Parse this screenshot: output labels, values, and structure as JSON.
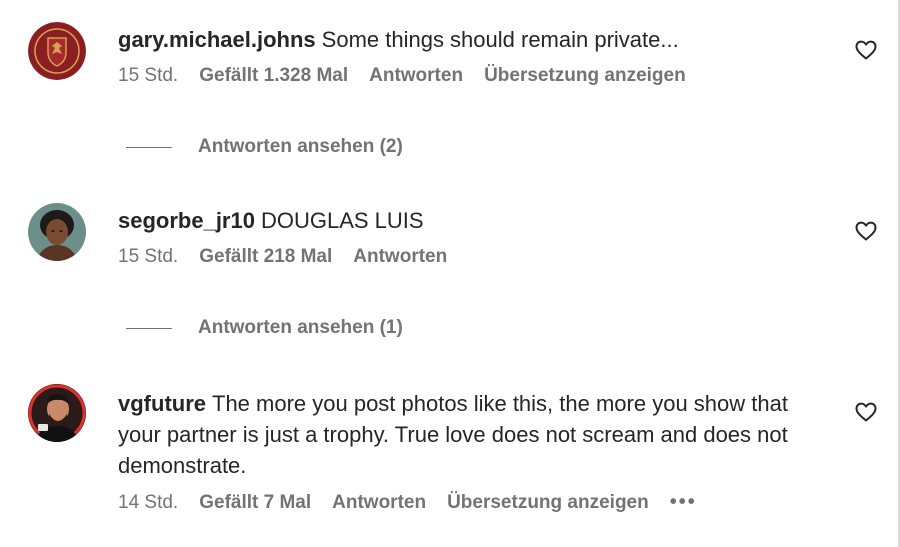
{
  "comments": [
    {
      "username": "gary.michael.johns",
      "text": "Some things should remain private...",
      "time": "15 Std.",
      "likes": "Gefällt 1.328 Mal",
      "reply": "Antworten",
      "translate": "Übersetzung anzeigen",
      "view_replies": "Antworten ansehen (2)"
    },
    {
      "username": "segorbe_jr10",
      "text": "DOUGLAS LUIS",
      "time": "15 Std.",
      "likes": "Gefällt 218 Mal",
      "reply": "Antworten",
      "view_replies": "Antworten ansehen (1)"
    },
    {
      "username": "vgfuture",
      "text": "The more you post photos like this, the more you show that your partner is just a trophy. True love does not scream and does not demonstrate.",
      "time": "14 Std.",
      "likes": "Gefällt 7 Mal",
      "reply": "Antworten",
      "translate": "Übersetzung anzeigen",
      "more": "•••"
    }
  ],
  "icons": {
    "like": "heart-outline-icon",
    "more": "more-options-icon"
  },
  "colors": {
    "text": "#262626",
    "secondary": "#737373",
    "avatar_1": "#8b1d23",
    "avatar_3": "#b3261e"
  }
}
